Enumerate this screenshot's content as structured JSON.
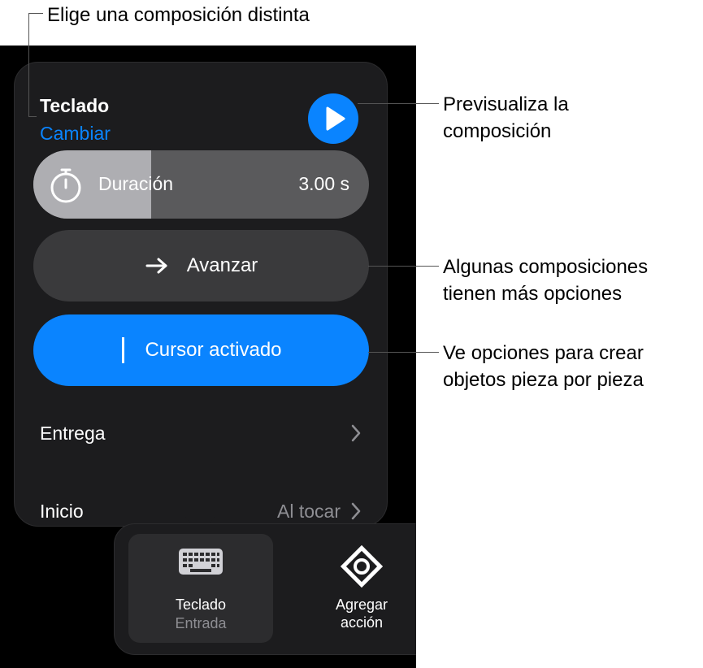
{
  "callouts": {
    "top": "Elige una composición distinta",
    "preview_line1": "Previsualiza la",
    "preview_line2": "composición",
    "options_line1": "Algunas composiciones",
    "options_line2": "tienen más opciones",
    "build_line1": "Ve opciones para crear",
    "build_line2": "objetos pieza por pieza"
  },
  "popover": {
    "title": "Teclado",
    "change_label": "Cambiar",
    "duration": {
      "label": "Duración",
      "value": "3.00 s",
      "fill_fraction": 0.35
    },
    "advance_label": "Avanzar",
    "cursor_label": "Cursor activado",
    "rows": [
      {
        "label": "Entrega",
        "value": ""
      },
      {
        "label": "Inicio",
        "value": "Al tocar"
      }
    ]
  },
  "toolbar": {
    "items": [
      {
        "label": "Teclado",
        "sub": "Entrada",
        "icon": "keyboard-icon"
      },
      {
        "label_line1": "Agregar",
        "label_line2": "acción",
        "icon": "add-action-icon"
      }
    ]
  },
  "colors": {
    "accent": "#0a84ff",
    "panel": "#1c1c1e",
    "secondary_text": "#8e8e93"
  }
}
